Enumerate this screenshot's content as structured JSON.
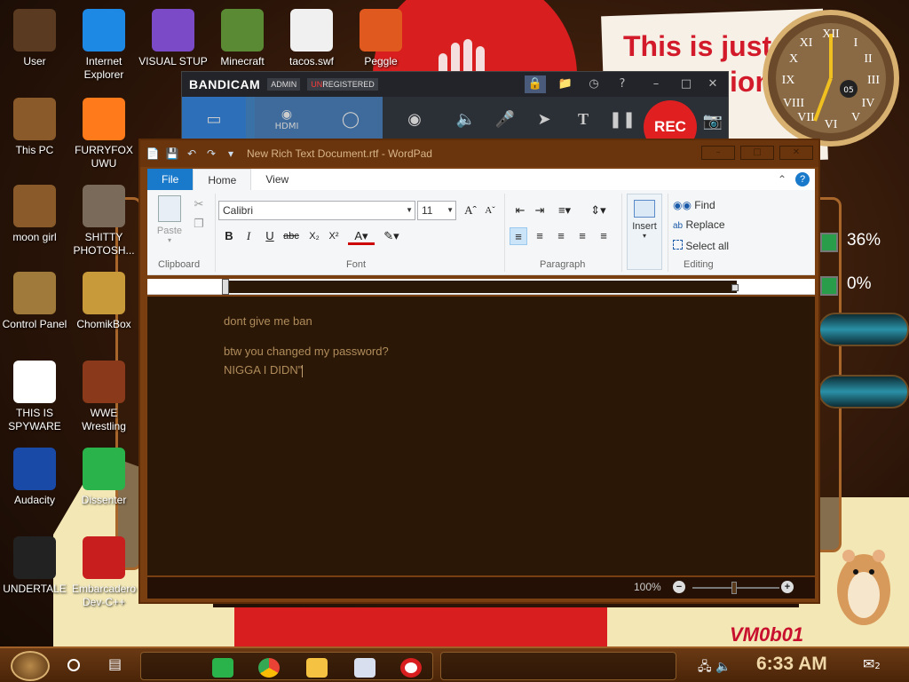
{
  "desktop": {
    "icons": [
      {
        "label": "User",
        "icon": "user-icon",
        "color": "#5a3a20"
      },
      {
        "label": "Internet Explorer",
        "icon": "edge-icon",
        "color": "#1e88e5"
      },
      {
        "label": "VISUAL STUP",
        "icon": "visual-studio-icon",
        "color": "#7b4ac7"
      },
      {
        "label": "Minecraft",
        "icon": "minecraft-icon",
        "color": "#5a8a34"
      },
      {
        "label": "tacos.swf",
        "icon": "flash-file-icon",
        "color": "#f0f0f0"
      },
      {
        "label": "Peggle",
        "icon": "peggle-icon",
        "color": "#e05a20"
      },
      {
        "label": "This PC",
        "icon": "computer-icon",
        "color": "#8a5a2a"
      },
      {
        "label": "FURRYFOX UWU",
        "icon": "firefox-icon",
        "color": "#ff7a1a"
      },
      {
        "label": "moon girl",
        "icon": "folder-icon",
        "color": "#8a5a2a"
      },
      {
        "label": "SHITTY PHOTOSH...",
        "icon": "gimp-icon",
        "color": "#7a6a5a"
      },
      {
        "label": "Control Panel",
        "icon": "control-panel-icon",
        "color": "#a07a3a"
      },
      {
        "label": "ChomikBox",
        "icon": "chomikbox-icon",
        "color": "#c89a3a"
      },
      {
        "label": "THIS IS SPYWARE",
        "icon": "chrome-icon",
        "color": "#ffffff"
      },
      {
        "label": "WWE Wrestling",
        "icon": "wwe-icon",
        "color": "#8a3a1a"
      },
      {
        "label": "Audacity",
        "icon": "audacity-icon",
        "color": "#1a4aa8"
      },
      {
        "label": "Dissenter",
        "icon": "dissenter-icon",
        "color": "#2ab34a"
      },
      {
        "label": "UNDERTALE",
        "icon": "unity-icon",
        "color": "#222222"
      },
      {
        "label": "Embarcadero Dev-C++",
        "icon": "devcpp-icon",
        "color": "#c81e1e"
      }
    ],
    "wallpaper_text": "This is just the",
    "wallpaper_text2": "... Onions",
    "wallpaper_corner": "VM0b01",
    "gauge_cpu": "36%",
    "gauge_mem": "0%"
  },
  "bandicam": {
    "logo": "BANDICAM",
    "tag_admin": "ADMIN",
    "tag_unregistered_u": "UN",
    "tag_unregistered_rest": "REGISTERED",
    "rec_label": "REC",
    "hdmi_label": "HDMI",
    "text_tool": "T"
  },
  "wordpad": {
    "title": "New Rich Text Document.rtf - WordPad",
    "tabs": {
      "file": "File",
      "home": "Home",
      "view": "View"
    },
    "clipboard": {
      "paste": "Paste",
      "group": "Clipboard"
    },
    "font": {
      "family": "Calibri",
      "size": "11",
      "group": "Font"
    },
    "paragraph": {
      "group": "Paragraph"
    },
    "insert": {
      "label": "Insert"
    },
    "editing": {
      "find": "Find",
      "replace": "Replace",
      "select_all": "Select all",
      "group": "Editing"
    },
    "document": {
      "lines": [
        "dont give me ban",
        "btw you changed my password?",
        "NIGGA I DIDN\""
      ]
    },
    "status": {
      "zoom": "100%"
    }
  },
  "taskbar": {
    "clock": "6:33 AM",
    "notifications": "2"
  }
}
